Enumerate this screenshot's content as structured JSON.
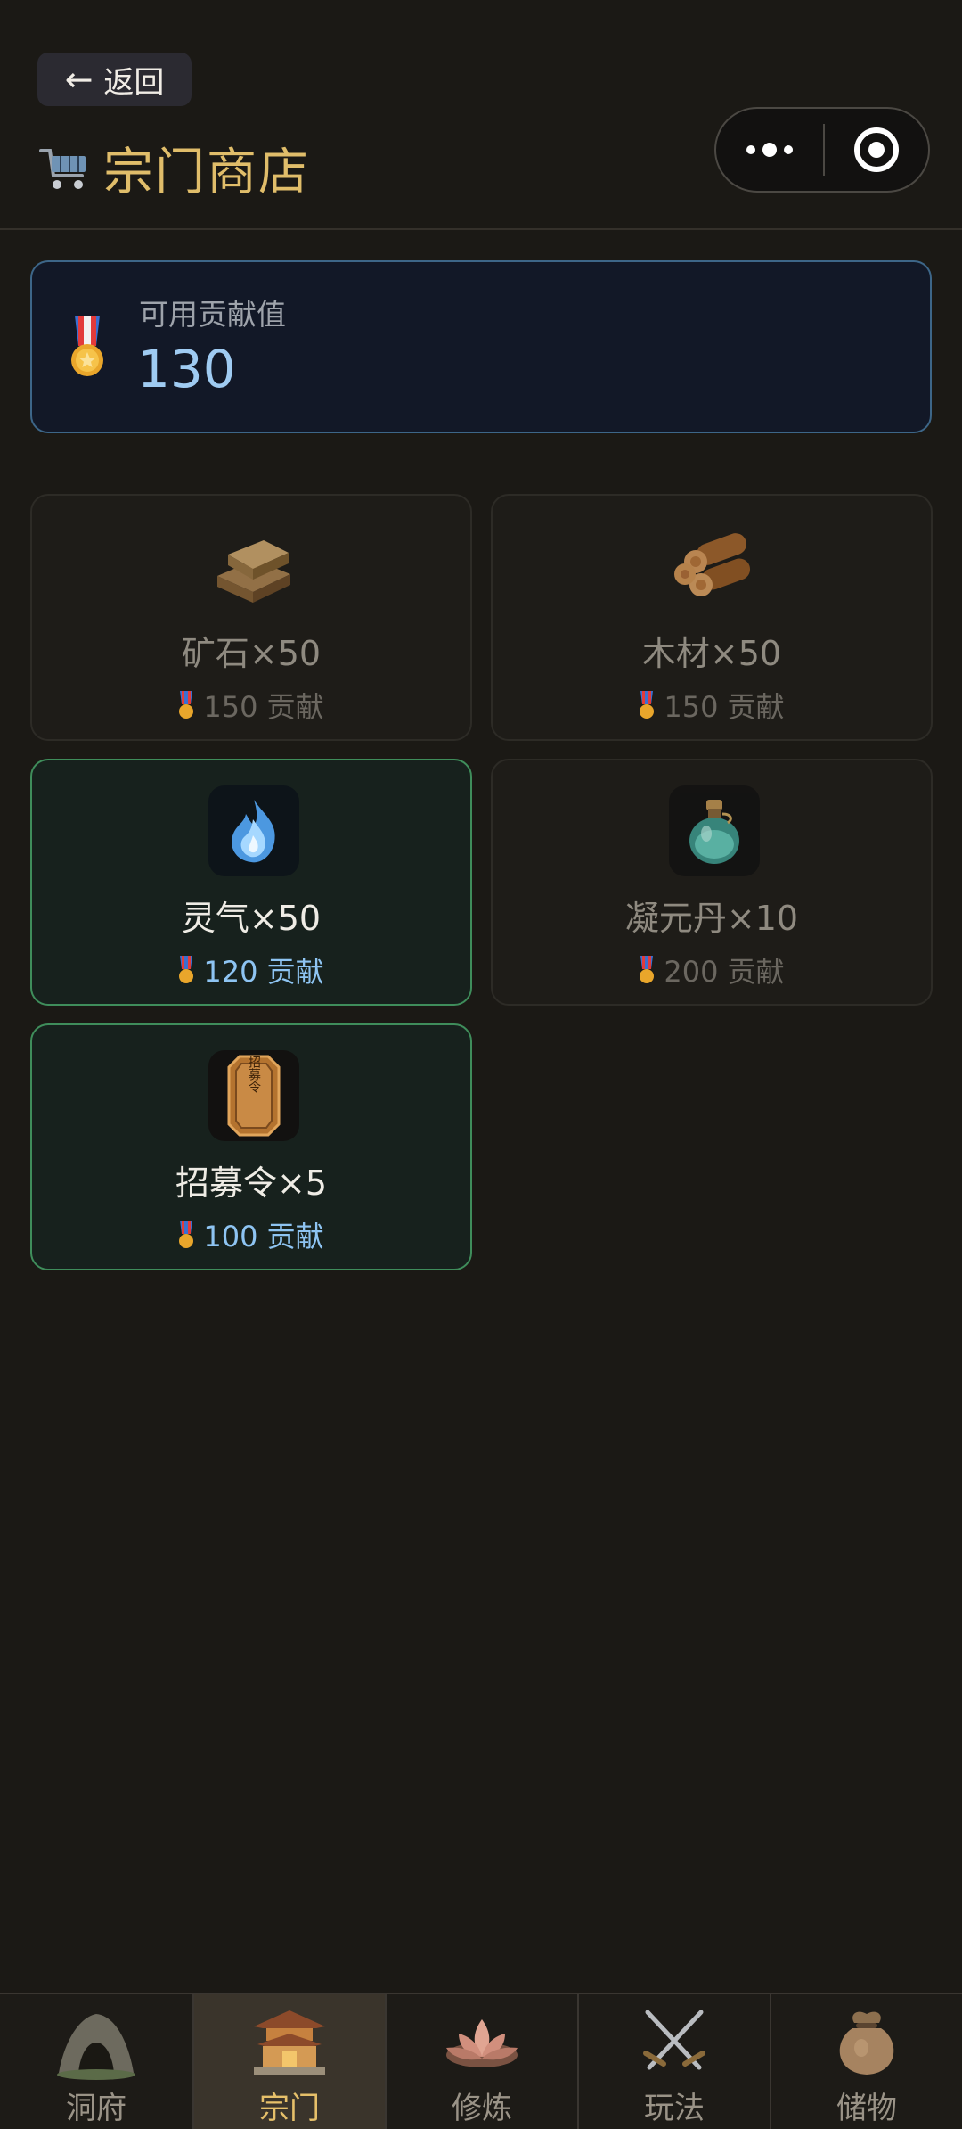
{
  "header": {
    "back_label": "返回",
    "title": "宗门商店",
    "title_icon": "cart-icon"
  },
  "contribution": {
    "label": "可用贡献值",
    "value": "130",
    "icon": "medal-icon"
  },
  "items": [
    {
      "name": "矿石×50",
      "cost": "150 贡献",
      "icon": "ore-icon",
      "affordable": false
    },
    {
      "name": "木材×50",
      "cost": "150 贡献",
      "icon": "wood-icon",
      "affordable": false
    },
    {
      "name": "灵气×50",
      "cost": "120 贡献",
      "icon": "spirit-flame-icon",
      "affordable": true
    },
    {
      "name": "凝元丹×10",
      "cost": "200 贡献",
      "icon": "potion-icon",
      "affordable": false
    },
    {
      "name": "招募令×5",
      "cost": "100 贡献",
      "icon": "recruit-token-icon",
      "affordable": true
    }
  ],
  "token_text": "招募令",
  "bottom_nav": [
    {
      "label": "洞府",
      "icon": "cave-icon",
      "active": false
    },
    {
      "label": "宗门",
      "icon": "sect-temple-icon",
      "active": true
    },
    {
      "label": "修炼",
      "icon": "lotus-icon",
      "active": false
    },
    {
      "label": "玩法",
      "icon": "crossed-swords-icon",
      "active": false
    },
    {
      "label": "储物",
      "icon": "storage-bag-icon",
      "active": false
    }
  ],
  "colors": {
    "background": "#1b1915",
    "title_gold": "#e0bd6a",
    "contrib_blue": "#9fcbf2",
    "affordable_border": "#3f8d5b"
  }
}
